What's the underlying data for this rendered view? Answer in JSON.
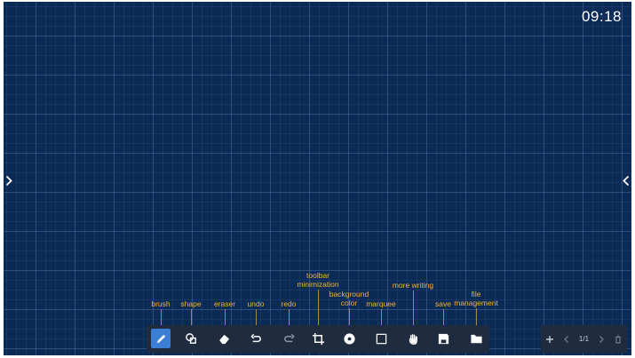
{
  "clock": "09:18",
  "toolbar": {
    "tools": [
      {
        "id": "brush",
        "icon": "pen-icon",
        "label": "brush"
      },
      {
        "id": "shape",
        "icon": "shape-icon",
        "label": "shape"
      },
      {
        "id": "eraser",
        "icon": "eraser-icon",
        "label": "eraser"
      },
      {
        "id": "undo",
        "icon": "undo-icon",
        "label": "undo"
      },
      {
        "id": "redo",
        "icon": "redo-icon",
        "label": "redo"
      },
      {
        "id": "toolbar_minimization",
        "icon": "crop-icon",
        "label": "toolbar\nminimization"
      },
      {
        "id": "background_color",
        "icon": "color-disc-icon",
        "label": "background\ncolor"
      },
      {
        "id": "marquee",
        "icon": "marquee-icon",
        "label": "marquee"
      },
      {
        "id": "more_writing",
        "icon": "hand-icon",
        "label": "more writing"
      },
      {
        "id": "save",
        "icon": "save-icon",
        "label": "save"
      },
      {
        "id": "file_management",
        "icon": "folder-icon",
        "label": "file\nmanagement"
      }
    ],
    "active": "brush"
  },
  "pages": {
    "indicator": "1/1",
    "add_icon": "plus-icon",
    "prev_icon": "chevron-left-icon",
    "next_icon": "chevron-right-icon",
    "delete_icon": "trash-icon"
  },
  "colors": {
    "board": "#0b2a56",
    "toolbar": "#1f2b3e",
    "active": "#3b7fd4",
    "callout": "#f2b531"
  }
}
